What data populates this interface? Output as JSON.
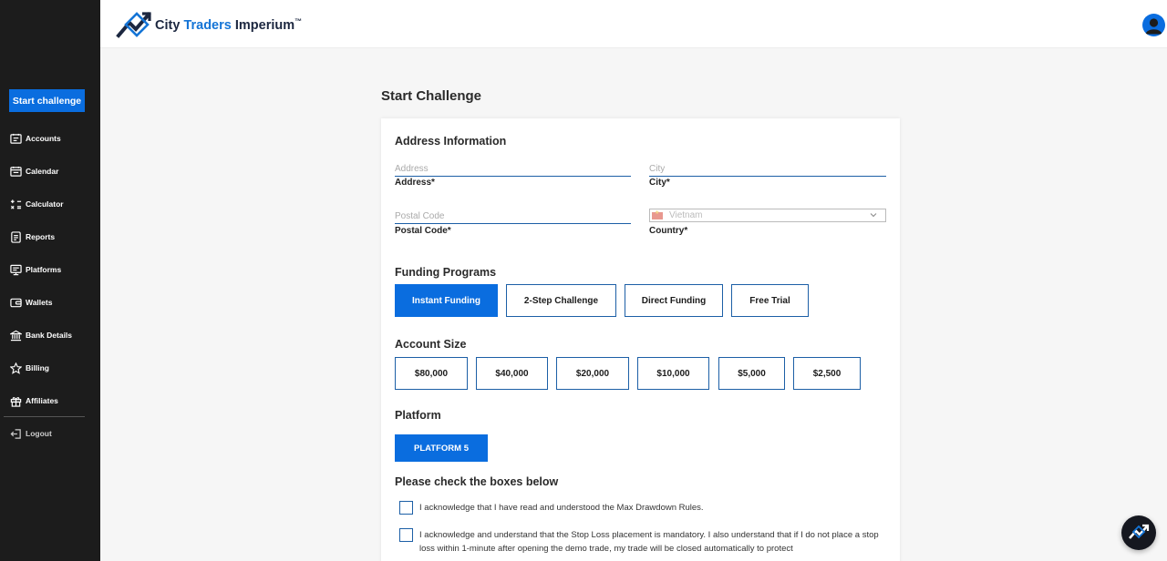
{
  "brand": {
    "name_part1": "City",
    "name_part2": "Traders",
    "name_part3": "Imperium",
    "tm": "™"
  },
  "sidebar": {
    "start_label": "Start challenge",
    "items": [
      {
        "label": "Accounts",
        "icon": "accounts-icon"
      },
      {
        "label": "Calendar",
        "icon": "calendar-icon"
      },
      {
        "label": "Calculator",
        "icon": "calculator-icon"
      },
      {
        "label": "Reports",
        "icon": "reports-icon"
      },
      {
        "label": "Platforms",
        "icon": "platforms-icon"
      },
      {
        "label": "Wallets",
        "icon": "wallet-icon"
      },
      {
        "label": "Bank Details",
        "icon": "bank-icon"
      },
      {
        "label": "Billing",
        "icon": "star-icon"
      },
      {
        "label": "Affiliates",
        "icon": "gift-icon"
      }
    ],
    "logout_label": "Logout"
  },
  "page": {
    "title": "Start Challenge"
  },
  "address": {
    "title": "Address Information",
    "address": {
      "placeholder": "Address",
      "label": "Address*"
    },
    "city": {
      "placeholder": "City",
      "label": "City*"
    },
    "postal": {
      "placeholder": "Postal Code",
      "label": "Postal Code*"
    },
    "country": {
      "value": "Vietnam",
      "label": "Country*"
    }
  },
  "funding": {
    "title": "Funding Programs",
    "options": [
      "Instant Funding",
      "2-Step Challenge",
      "Direct Funding",
      "Free Trial"
    ],
    "selected": "Instant Funding"
  },
  "account_size": {
    "title": "Account Size",
    "options": [
      "$80,000",
      "$40,000",
      "$20,000",
      "$10,000",
      "$5,000",
      "$2,500"
    ]
  },
  "platform": {
    "title": "Platform",
    "button": "PLATFORM 5"
  },
  "checks": {
    "title": "Please check the boxes below",
    "item1": "I acknowledge that I have read and understood the Max Drawdown Rules.",
    "item2": "I acknowledge and understand that the Stop Loss placement is mandatory. I also understand that if I do not place a stop loss within 1-minute after opening the demo trade, my trade will be closed automatically to protect"
  },
  "colors": {
    "accent": "#0a6ddf",
    "sidebar_bg": "#1c1c1c",
    "border_blue": "#1c5fa6"
  }
}
